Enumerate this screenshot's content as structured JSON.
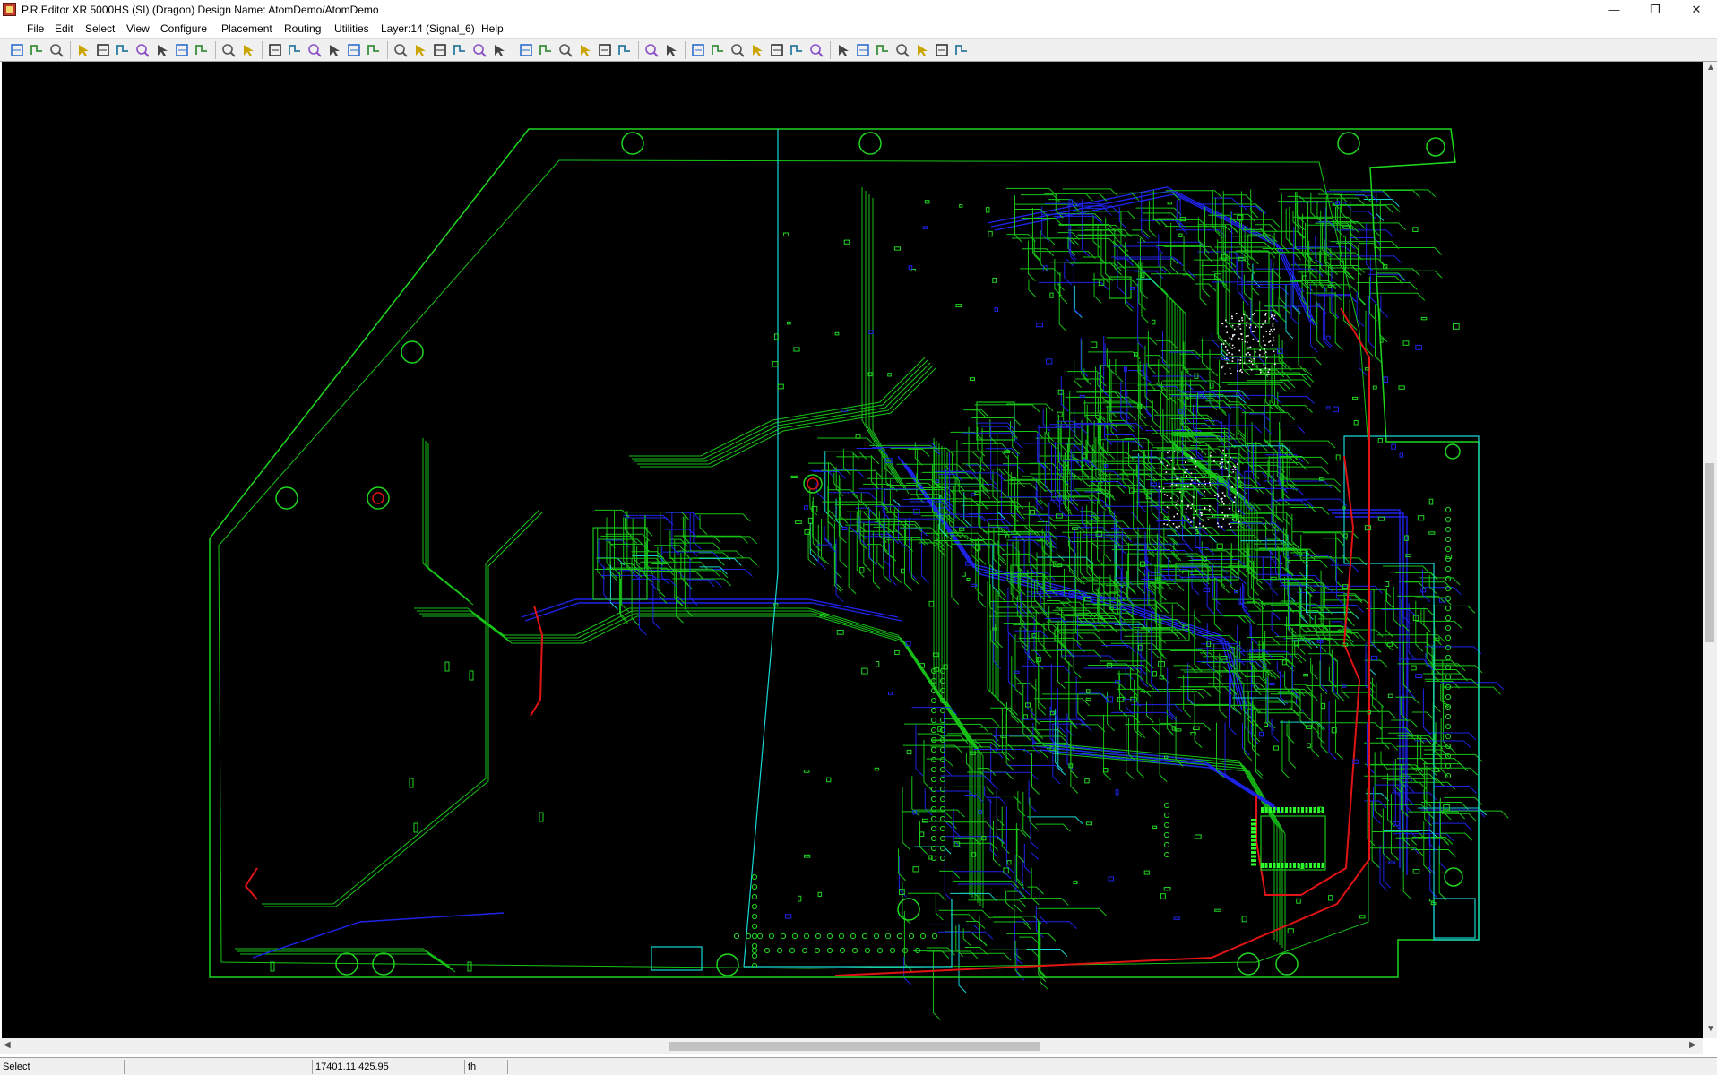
{
  "window": {
    "title": "P.R.Editor XR 5000HS (SI) (Dragon)    Design Name: AtomDemo/AtomDemo",
    "minimize": "—",
    "restore": "❐",
    "close": "✕"
  },
  "menu": [
    "File",
    "Edit",
    "Select",
    "View",
    "Configure",
    "Placement",
    "Routing",
    "Utilities",
    "Layer:14 (Signal_6)",
    "Help"
  ],
  "toolbar": {
    "icons": [
      "open-layer-icon",
      "grid-icon",
      "pan-icon",
      "smile-icon",
      "fit-window-icon",
      "redraw-icon",
      "zoom-area-icon",
      "zoom-in-icon",
      "zoom-out-icon",
      "zoom-previous-icon",
      "select-pointer-icon",
      "move-icon",
      "route-icon",
      "route-bend-icon",
      "route-step-icon",
      "route-end-icon",
      "layer-stack-icon",
      "wire-icon",
      "wire-bend-icon",
      "bus-icon",
      "diff-pair-icon",
      "line-icon",
      "meander-icon",
      "fanout-icon",
      "save-icon",
      "print-icon",
      "cut-icon",
      "copy-icon",
      "paste-icon",
      "delete-icon",
      "undo-icon",
      "redo-icon",
      "properties-icon",
      "net-icon",
      "via-icon",
      "swap-icon",
      "align-icon",
      "array-icon",
      "autoroute-icon",
      "check-icon",
      "drc-icon",
      "clear-drc-icon",
      "help-icon",
      "measure-icon",
      "hand-icon",
      "highlight-icon"
    ]
  },
  "canvas": {
    "background": "#000000",
    "outline": "#1fd61f",
    "trace_green": "#17c417",
    "trace_blue": "#1e23e8",
    "trace_red": "#e01414",
    "cyan": "#19d6d6"
  },
  "status": {
    "mode": "Select",
    "coords": "17401.11     425.95",
    "unit": "th"
  }
}
